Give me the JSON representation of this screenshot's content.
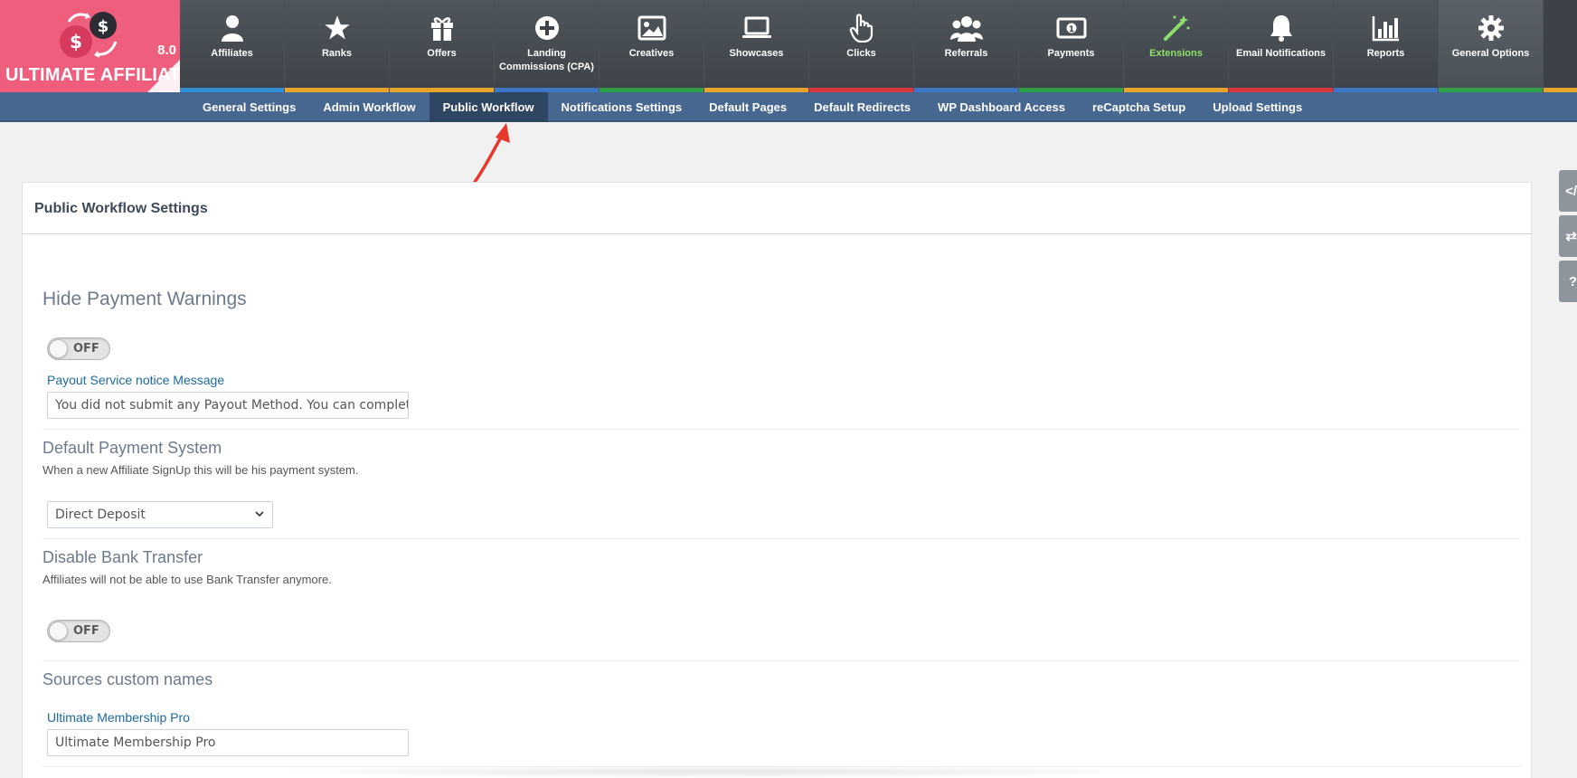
{
  "brand": {
    "name": "ULTIMATE AFFILIATE",
    "version": "8.0",
    "color": "#ef5e7d"
  },
  "menu": [
    {
      "label": "Affiliates",
      "icon": "user-icon",
      "stripe": "#2f8ed4"
    },
    {
      "label": "Ranks",
      "icon": "star-icon",
      "stripe": "#e8a32a"
    },
    {
      "label": "Offers",
      "icon": "gift-icon",
      "stripe": "#e8a32a"
    },
    {
      "label": "Landing Commissions (CPA)",
      "icon": "plus-circle-icon",
      "stripe": "#3d76c4"
    },
    {
      "label": "Creatives",
      "icon": "image-icon",
      "stripe": "#2fa04a"
    },
    {
      "label": "Showcases",
      "icon": "laptop-icon",
      "stripe": "#e8a32a"
    },
    {
      "label": "Clicks",
      "icon": "pointer-hand-icon",
      "stripe": "#d9363e"
    },
    {
      "label": "Referrals",
      "icon": "users-icon",
      "stripe": "#3d76c4"
    },
    {
      "label": "Payments",
      "icon": "money-icon",
      "stripe": "#2fa04a"
    },
    {
      "label": "Extensions",
      "icon": "magic-wand-icon",
      "stripe": "#e8a32a"
    },
    {
      "label": "Email Notifications",
      "icon": "bell-icon",
      "stripe": "#d9363e"
    },
    {
      "label": "Reports",
      "icon": "bar-chart-icon",
      "stripe": "#3d76c4"
    },
    {
      "label": "General Options",
      "icon": "gear-icon",
      "stripe": "#2fa04a"
    }
  ],
  "menu_trailing_stripe": "#e8a32a",
  "subnav": {
    "tabs": [
      "General Settings",
      "Admin Workflow",
      "Public Workflow",
      "Notifications Settings",
      "Default Pages",
      "Default Redirects",
      "WP Dashboard Access",
      "reCaptcha Setup",
      "Upload Settings"
    ],
    "active": "Public Workflow"
  },
  "card": {
    "title": "Public Workflow Settings",
    "hide_payment_warnings": {
      "heading": "Hide Payment Warnings",
      "toggle": "OFF",
      "field_label": "Payout Service notice Message",
      "field_value": "You did not submit any Payout Method. You can complete s"
    },
    "default_payment": {
      "heading": "Default Payment System",
      "description": "When a new Affiliate SignUp this will be his payment system.",
      "selected": "Direct Deposit"
    },
    "disable_bank": {
      "heading": "Disable Bank Transfer",
      "description": "Affiliates will not be able to use Bank Transfer anymore.",
      "toggle": "OFF"
    },
    "sources": {
      "heading": "Sources custom names",
      "field_label": "Ultimate Membership Pro",
      "field_value": "Ultimate Membership Pro"
    }
  },
  "sidetools": [
    "</",
    "⇄",
    "?"
  ]
}
